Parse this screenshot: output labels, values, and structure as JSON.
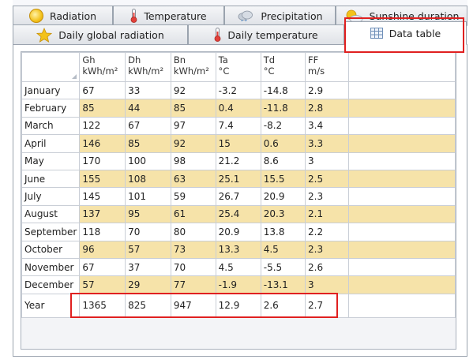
{
  "tabs_row1": [
    {
      "label": "Radiation",
      "icon": "sun-icon"
    },
    {
      "label": "Temperature",
      "icon": "thermometer-icon"
    },
    {
      "label": "Precipitation",
      "icon": "cloud-icon"
    },
    {
      "label": "Sunshine duration",
      "icon": "sun-cloud-icon"
    }
  ],
  "tabs_row2": [
    {
      "label": "Daily global radiation",
      "icon": "star-icon"
    },
    {
      "label": "Daily temperature",
      "icon": "thermometer-icon"
    },
    {
      "label": "Data table",
      "icon": "table-icon",
      "active": true
    }
  ],
  "table": {
    "columns": [
      {
        "name": "Gh",
        "unit": "kWh/m²"
      },
      {
        "name": "Dh",
        "unit": "kWh/m²"
      },
      {
        "name": "Bn",
        "unit": "kWh/m²"
      },
      {
        "name": "Ta",
        "unit": "°C"
      },
      {
        "name": "Td",
        "unit": "°C"
      },
      {
        "name": "FF",
        "unit": "m/s"
      }
    ],
    "rows": [
      {
        "label": "January",
        "values": [
          "67",
          "33",
          "92",
          "-3.2",
          "-14.8",
          "2.9"
        ]
      },
      {
        "label": "February",
        "values": [
          "85",
          "44",
          "85",
          "0.4",
          "-11.8",
          "2.8"
        ]
      },
      {
        "label": "March",
        "values": [
          "122",
          "67",
          "97",
          "7.4",
          "-8.2",
          "3.4"
        ]
      },
      {
        "label": "April",
        "values": [
          "146",
          "85",
          "92",
          "15",
          "0.6",
          "3.3"
        ]
      },
      {
        "label": "May",
        "values": [
          "170",
          "100",
          "98",
          "21.2",
          "8.6",
          "3"
        ]
      },
      {
        "label": "June",
        "values": [
          "155",
          "108",
          "63",
          "25.1",
          "15.5",
          "2.5"
        ]
      },
      {
        "label": "July",
        "values": [
          "145",
          "101",
          "59",
          "26.7",
          "20.9",
          "2.3"
        ]
      },
      {
        "label": "August",
        "values": [
          "137",
          "95",
          "61",
          "25.4",
          "20.3",
          "2.1"
        ]
      },
      {
        "label": "September",
        "values": [
          "118",
          "70",
          "80",
          "20.9",
          "13.8",
          "2.2"
        ]
      },
      {
        "label": "October",
        "values": [
          "96",
          "57",
          "73",
          "13.3",
          "4.5",
          "2.3"
        ]
      },
      {
        "label": "November",
        "values": [
          "67",
          "37",
          "70",
          "4.5",
          "-5.5",
          "2.6"
        ]
      },
      {
        "label": "December",
        "values": [
          "57",
          "29",
          "77",
          "-1.9",
          "-13.1",
          "3"
        ]
      }
    ],
    "total": {
      "label": "Year",
      "values": [
        "1365",
        "825",
        "947",
        "12.9",
        "2.6",
        "2.7"
      ]
    }
  },
  "colors": {
    "stripe": "#f6e3a9",
    "highlight": "#e02020",
    "grid_line": "#c9ced6"
  }
}
